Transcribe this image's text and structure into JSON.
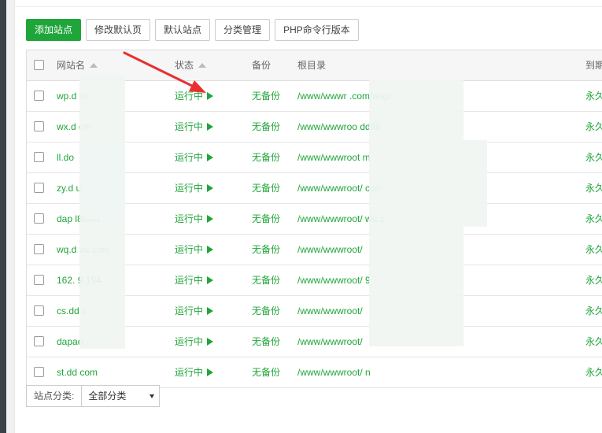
{
  "toolbar": {
    "add_site": "添加站点",
    "edit_default_page": "修改默认页",
    "default_site": "默认站点",
    "category_manage": "分类管理",
    "php_cli_version": "PHP命令行版本"
  },
  "table": {
    "headers": {
      "site_name": "网站名",
      "status": "状态",
      "backup": "备份",
      "root": "根目录",
      "expire": "到期"
    },
    "rows": [
      {
        "name": "wp.d          m",
        "status": "运行中",
        "backup": "无备份",
        "root": "/www/wwwr                        .com/wap",
        "expire": "永久"
      },
      {
        "name": "wx.d          om",
        "status": "运行中",
        "backup": "无备份",
        "root": "/www/wwwroo      dd88",
        "expire": "永久"
      },
      {
        "name": "ll.do",
        "status": "运行中",
        "backup": "无备份",
        "root": "/www/wwwroot              m",
        "expire": "永久"
      },
      {
        "name": "zy.d        u.",
        "status": "运行中",
        "backup": "无备份",
        "root": "/www/wwwroot/              com",
        "expire": "永久"
      },
      {
        "name": "dap      l88wu",
        "status": "运行中",
        "backup": "无备份",
        "root": "/www/wwwroot/           wu.c",
        "expire": "永久"
      },
      {
        "name": "wq.d       vu.com",
        "status": "运行中",
        "backup": "无备份",
        "root": "/www/wwwroot/",
        "expire": "永久"
      },
      {
        "name": "162.       9.194",
        "status": "运行中",
        "backup": "无备份",
        "root": "/www/wwwroot/          9",
        "expire": "永久"
      },
      {
        "name": "cs.dd          c",
        "status": "运行中",
        "backup": "无备份",
        "root": "/www/wwwroot/",
        "expire": "永久"
      },
      {
        "name": "dapao",
        "status": "运行中",
        "backup": "无备份",
        "root": "/www/wwwroot/",
        "expire": "永久"
      },
      {
        "name": "st.dd          com",
        "status": "运行中",
        "backup": "无备份",
        "root": "/www/wwwroot/          n",
        "expire": "永久"
      }
    ]
  },
  "footer": {
    "category_label": "站点分类:",
    "category_value": "全部分类"
  },
  "colors": {
    "accent": "#20a53a",
    "annotation_arrow": "#e8302f"
  }
}
